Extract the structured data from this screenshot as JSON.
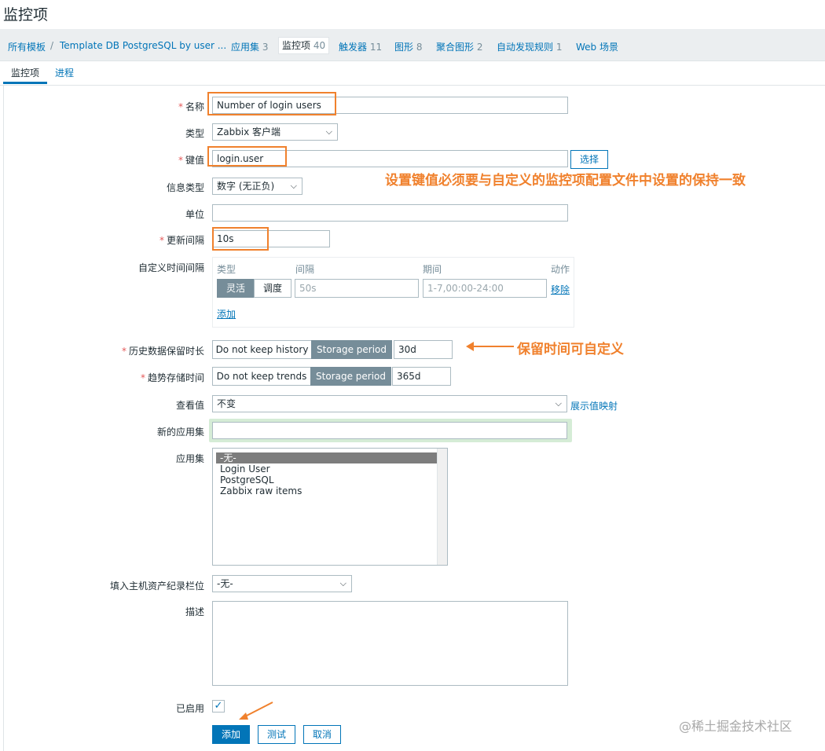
{
  "page_title": "监控项",
  "breadcrumb": [
    {
      "label": "所有模板"
    },
    {
      "label": "Template DB PostgreSQL by user ..."
    }
  ],
  "nav": [
    {
      "label": "应用集",
      "count": "3"
    },
    {
      "label": "监控项",
      "count": "40"
    },
    {
      "label": "触发器",
      "count": "11"
    },
    {
      "label": "图形",
      "count": "8"
    },
    {
      "label": "聚合图形",
      "count": "2"
    },
    {
      "label": "自动发现规则",
      "count": "1"
    },
    {
      "label": "Web 场景",
      "count": ""
    }
  ],
  "tabs": [
    {
      "label": "监控项"
    },
    {
      "label": "进程"
    }
  ],
  "form": {
    "name": {
      "label": "名称",
      "value": "Number of login users"
    },
    "type": {
      "label": "类型",
      "value": "Zabbix 客户端"
    },
    "key": {
      "label": "键值",
      "value": "login.user",
      "select_button": "选择"
    },
    "info_type": {
      "label": "信息类型",
      "value": "数字 (无正负)"
    },
    "units": {
      "label": "单位",
      "value": ""
    },
    "update_interval": {
      "label": "更新间隔",
      "value": "10s"
    },
    "custom_intervals": {
      "label": "自定义时间间隔",
      "headers": {
        "type": "类型",
        "interval": "间隔",
        "period": "期间",
        "action": "动作"
      },
      "row": {
        "flexible": "灵活",
        "scheduling": "调度",
        "interval_placeholder": "50s",
        "period_placeholder": "1-7,00:00-24:00",
        "remove": "移除"
      },
      "add": "添加"
    },
    "history": {
      "label": "历史数据保留时长",
      "off": "Do not keep history",
      "on": "Storage period",
      "value": "30d"
    },
    "trends": {
      "label": "趋势存储时间",
      "off": "Do not keep trends",
      "on": "Storage period",
      "value": "365d"
    },
    "show_value": {
      "label": "查看值",
      "value": "不变",
      "link": "展示值映射"
    },
    "new_application": {
      "label": "新的应用集",
      "value": ""
    },
    "applications": {
      "label": "应用集",
      "options": [
        "-无-",
        "Login User",
        "PostgreSQL",
        "Zabbix raw items"
      ]
    },
    "inventory": {
      "label": "填入主机资产纪录栏位",
      "value": "-无-"
    },
    "description": {
      "label": "描述",
      "value": ""
    },
    "enabled": {
      "label": "已启用"
    },
    "buttons": {
      "add": "添加",
      "test": "测试",
      "cancel": "取消"
    }
  },
  "annotations": {
    "key_note": "设置键值必须要与自定义的监控项配置文件中设置的保持一致",
    "history_note": "保留时间可自定义"
  },
  "watermark": "@稀土掘金技术社区",
  "colors": {
    "accent": "#0275b8",
    "annotation": "#f0812d",
    "required": "#e45959"
  }
}
